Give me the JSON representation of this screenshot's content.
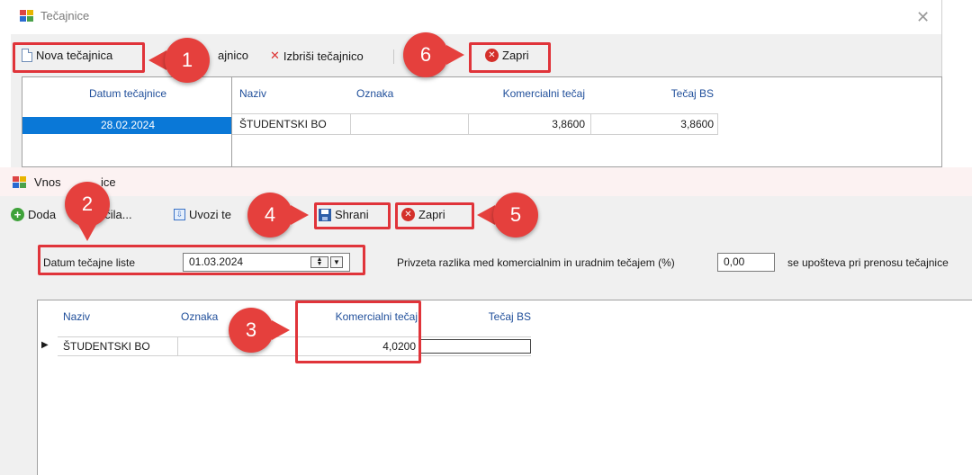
{
  "back_window": {
    "title": "Tečajnice",
    "toolbar": {
      "new_label": "Nova tečajnica",
      "edit_label_fragment": "ajnico",
      "delete_label": "Izbriši tečajnico",
      "close_label": "Zapri"
    },
    "dates_grid": {
      "header": "Datum tečajnice",
      "rows": [
        "28.02.2024"
      ]
    },
    "rates_grid": {
      "headers": [
        "Naziv",
        "Oznaka",
        "Komercialni tečaj",
        "Tečaj BS"
      ],
      "rows": [
        {
          "naziv": "ŠTUDENTSKI BO",
          "oznaka": "",
          "komercialni": "3,8600",
          "bs": "3,8600"
        }
      ]
    }
  },
  "front_window": {
    "title_prefix": "Vnos",
    "title_suffix": "ice",
    "toolbar": {
      "add_prefix": "Doda",
      "add_suffix": "n plačila...",
      "import_fragment": "Uvozi te",
      "save_label": "Shrani",
      "close_label": "Zapri"
    },
    "date_label": "Datum tečajne liste",
    "date_value": "01.03.2024",
    "diff_label": "Privzeta razlika med komercialnim in uradnim tečajem (%)",
    "diff_value": "0,00",
    "note": "se upošteva pri prenosu tečajnice",
    "grid": {
      "headers": [
        "Naziv",
        "Oznaka",
        "Komercialni tečaj",
        "Tečaj BS"
      ],
      "row_marker": "▶",
      "rows": [
        {
          "naziv": "ŠTUDENTSKI BO",
          "komercialni": "4,0200",
          "bs": ""
        }
      ]
    }
  },
  "markers": [
    "1",
    "2",
    "3",
    "4",
    "5",
    "6"
  ],
  "colors": {
    "highlight": "#e0343a",
    "marker": "#e5403d",
    "selected_row": "#0a78d7",
    "header_text": "#1f4e9a"
  }
}
